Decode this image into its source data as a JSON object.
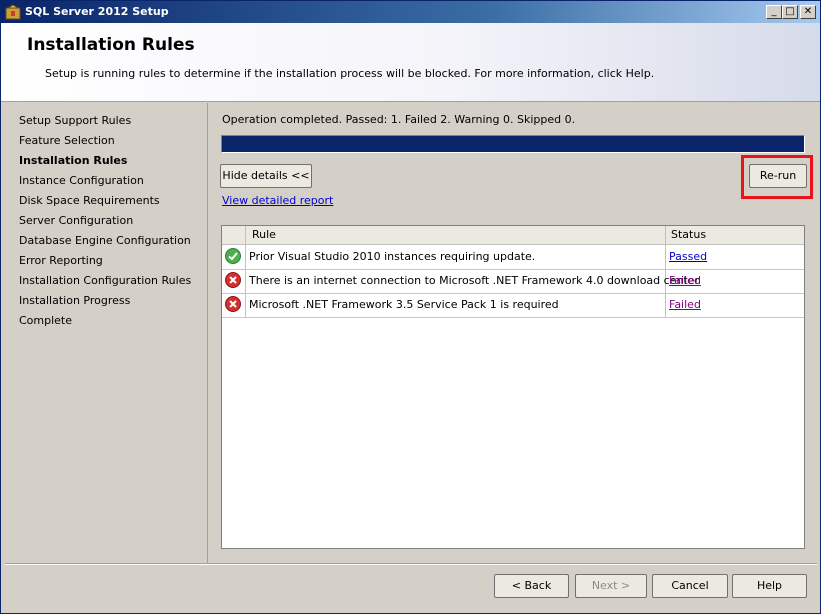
{
  "window": {
    "title": "SQL Server 2012 Setup",
    "minimize": "_",
    "maximize": "□",
    "close": "✕"
  },
  "header": {
    "title": "Installation Rules",
    "description": "Setup is running rules to determine if the installation process will be blocked. For more information, click Help."
  },
  "nav": {
    "items": [
      {
        "label": "Setup Support Rules"
      },
      {
        "label": "Feature Selection"
      },
      {
        "label": "Installation Rules"
      },
      {
        "label": "Instance Configuration"
      },
      {
        "label": "Disk Space Requirements"
      },
      {
        "label": "Server Configuration"
      },
      {
        "label": "Database Engine Configuration"
      },
      {
        "label": "Error Reporting"
      },
      {
        "label": "Installation Configuration Rules"
      },
      {
        "label": "Installation Progress"
      },
      {
        "label": "Complete"
      }
    ],
    "active_index": 2
  },
  "content": {
    "operation_status": "Operation completed. Passed: 1.   Failed 2.   Warning 0.   Skipped 0.",
    "progress_percent": 100,
    "hide_details_label": "Hide details <<",
    "rerun_label": "Re-run",
    "view_report_label": "View detailed report"
  },
  "grid": {
    "columns": {
      "rule": "Rule",
      "status": "Status"
    },
    "rows": [
      {
        "rule": "Prior Visual Studio 2010 instances requiring update.",
        "status": "Passed",
        "icon": "check-icon"
      },
      {
        "rule": "There is an internet connection to Microsoft .NET Framework 4.0 download center",
        "status": "Failed",
        "icon": "error-icon"
      },
      {
        "rule": "Microsoft .NET Framework 3.5 Service Pack 1 is required",
        "status": "Failed",
        "icon": "error-icon"
      }
    ]
  },
  "footer": {
    "back_label": "< Back",
    "next_label": "Next >",
    "cancel_label": "Cancel",
    "help_label": "Help"
  },
  "colors": {
    "accent": "#0a246a",
    "highlight": "#e8141c",
    "passed": "#4caf50",
    "failed": "#d32f2f"
  }
}
